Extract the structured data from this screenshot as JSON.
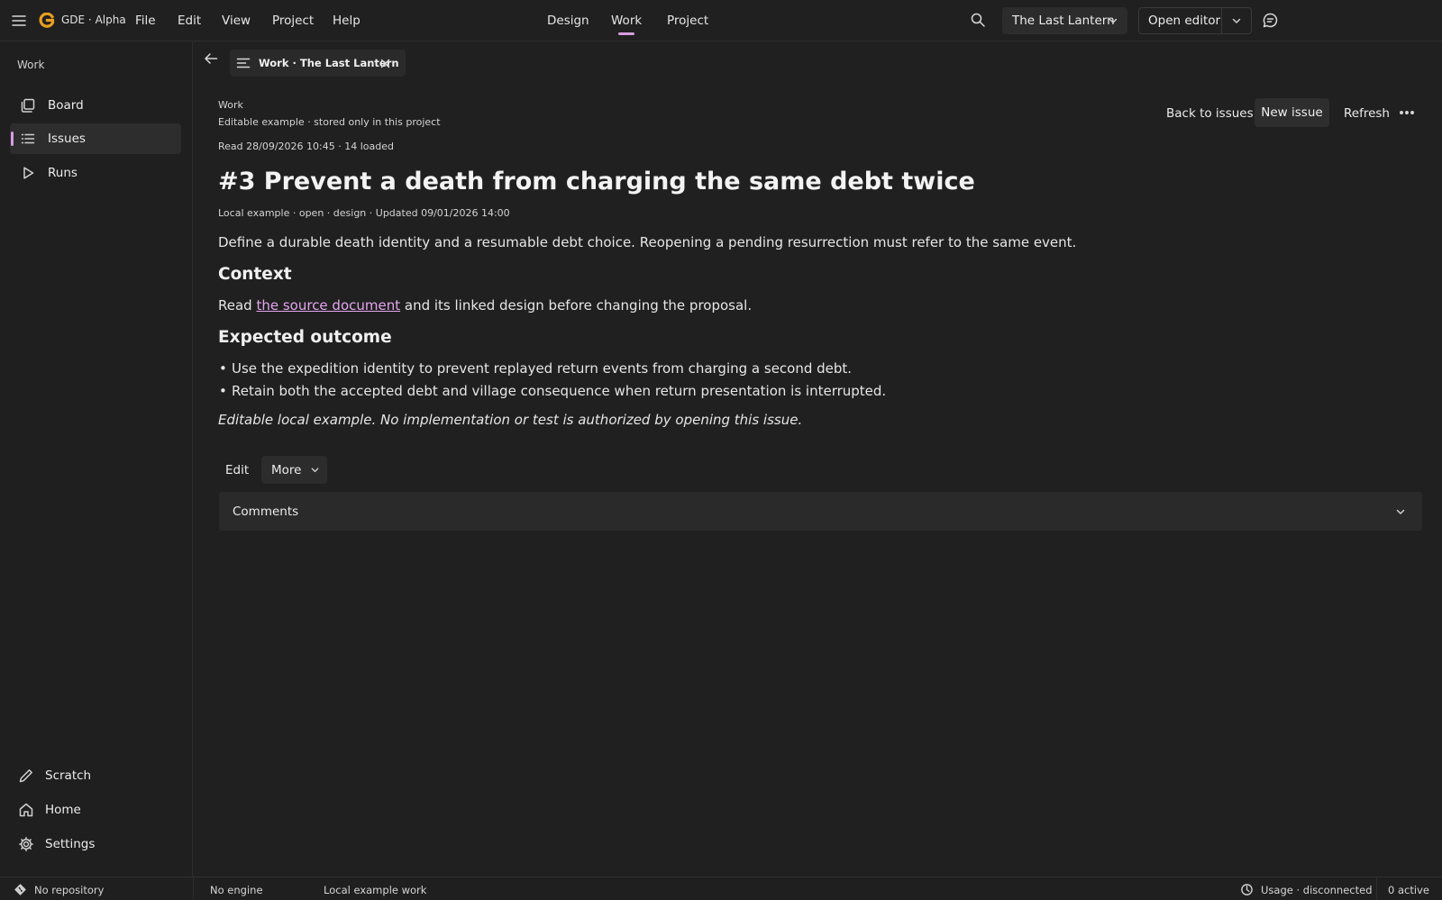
{
  "app": {
    "name": "GDE · Alpha"
  },
  "menu": [
    "File",
    "Edit",
    "View",
    "Project",
    "Help"
  ],
  "nav_tabs": [
    {
      "label": "Design",
      "active": false
    },
    {
      "label": "Work",
      "active": true
    },
    {
      "label": "Project",
      "active": false
    }
  ],
  "topbar": {
    "project": "The Last Lantern",
    "open_editor": "Open editor"
  },
  "sidebar": {
    "section": "Work",
    "items": [
      {
        "label": "Board",
        "icon": "board-icon",
        "active": false
      },
      {
        "label": "Issues",
        "icon": "list-icon",
        "active": true
      },
      {
        "label": "Runs",
        "icon": "play-icon",
        "active": false
      }
    ],
    "bottom": [
      {
        "label": "Scratch",
        "icon": "pencil-icon"
      },
      {
        "label": "Home",
        "icon": "home-icon"
      },
      {
        "label": "Settings",
        "icon": "gear-icon"
      }
    ]
  },
  "tab": {
    "title": "Work · The Last Lantern"
  },
  "header": {
    "section": "Work",
    "storage": "Editable example · stored only in this project",
    "read_status": "Read 28/09/2026 10:45 · 14 loaded"
  },
  "actions": {
    "back": "Back to issues",
    "new_issue": "New issue",
    "refresh": "Refresh"
  },
  "issue": {
    "title": "#3 Prevent a death from charging the same debt twice",
    "meta": "Local example · open · design · Updated 09/01/2026 14:00",
    "summary": "Define a durable death identity and a resumable debt choice. Reopening a pending resurrection must refer to the same event.",
    "context_heading": "Context",
    "context_before": "Read ",
    "context_link": "the source document",
    "context_after": " and its linked design before changing the proposal.",
    "outcome_heading": "Expected outcome",
    "outcomes": [
      "Use the expedition identity to prevent replayed return events from charging a second debt.",
      "Retain both the accepted debt and village consequence when return presentation is interrupted."
    ],
    "note": "Editable local example. No implementation or test is authorized by opening this issue.",
    "edit_label": "Edit",
    "more_label": "More",
    "comments_label": "Comments"
  },
  "statusbar": {
    "repository": "No repository",
    "engine": "No engine",
    "work": "Local example work",
    "usage": "Usage · disconnected",
    "active": "0 active"
  },
  "colors": {
    "accent": "#d79ce0",
    "link": "#e3a6ee",
    "logo": "#e8a020"
  }
}
